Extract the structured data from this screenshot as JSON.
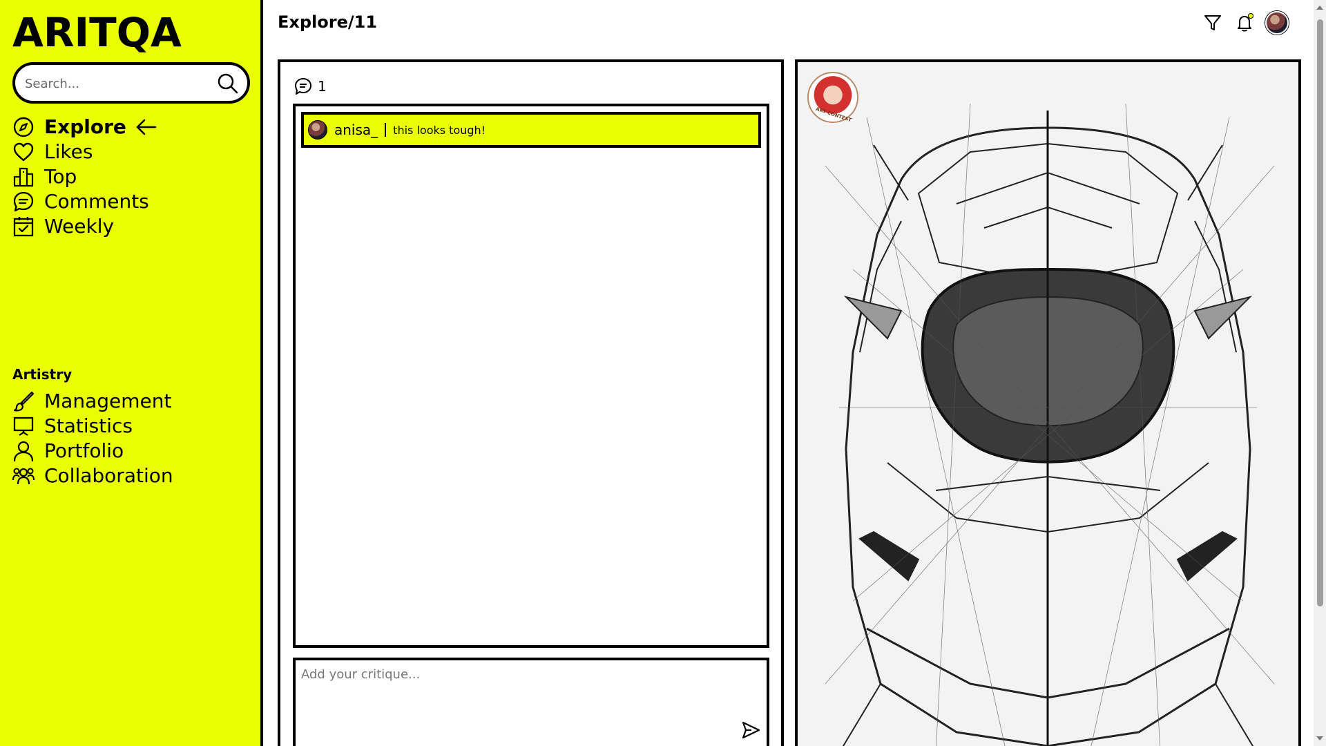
{
  "app": {
    "logo": "ARITQA"
  },
  "search": {
    "placeholder": "Search..."
  },
  "nav": {
    "items": [
      {
        "label": "Explore",
        "icon": "compass-icon",
        "active": true
      },
      {
        "label": "Likes",
        "icon": "heart-icon"
      },
      {
        "label": "Top",
        "icon": "podium-icon"
      },
      {
        "label": "Comments",
        "icon": "chat-icon"
      },
      {
        "label": "Weekly",
        "icon": "calendar-check-icon"
      }
    ]
  },
  "artistry": {
    "title": "Artistry",
    "items": [
      {
        "label": "Management",
        "icon": "brush-icon"
      },
      {
        "label": "Statistics",
        "icon": "easel-icon"
      },
      {
        "label": "Portfolio",
        "icon": "user-icon"
      },
      {
        "label": "Collaboration",
        "icon": "users-icon"
      }
    ]
  },
  "header": {
    "title": "Explore/11"
  },
  "comments": {
    "count": "1",
    "list": [
      {
        "user": "anisa_",
        "text": "this looks tough!"
      }
    ]
  },
  "critique": {
    "placeholder": "Add your critique..."
  },
  "artwork": {
    "badge_text": "ART CONTEST"
  },
  "colors": {
    "accent": "#eaff00",
    "border": "#000000"
  }
}
